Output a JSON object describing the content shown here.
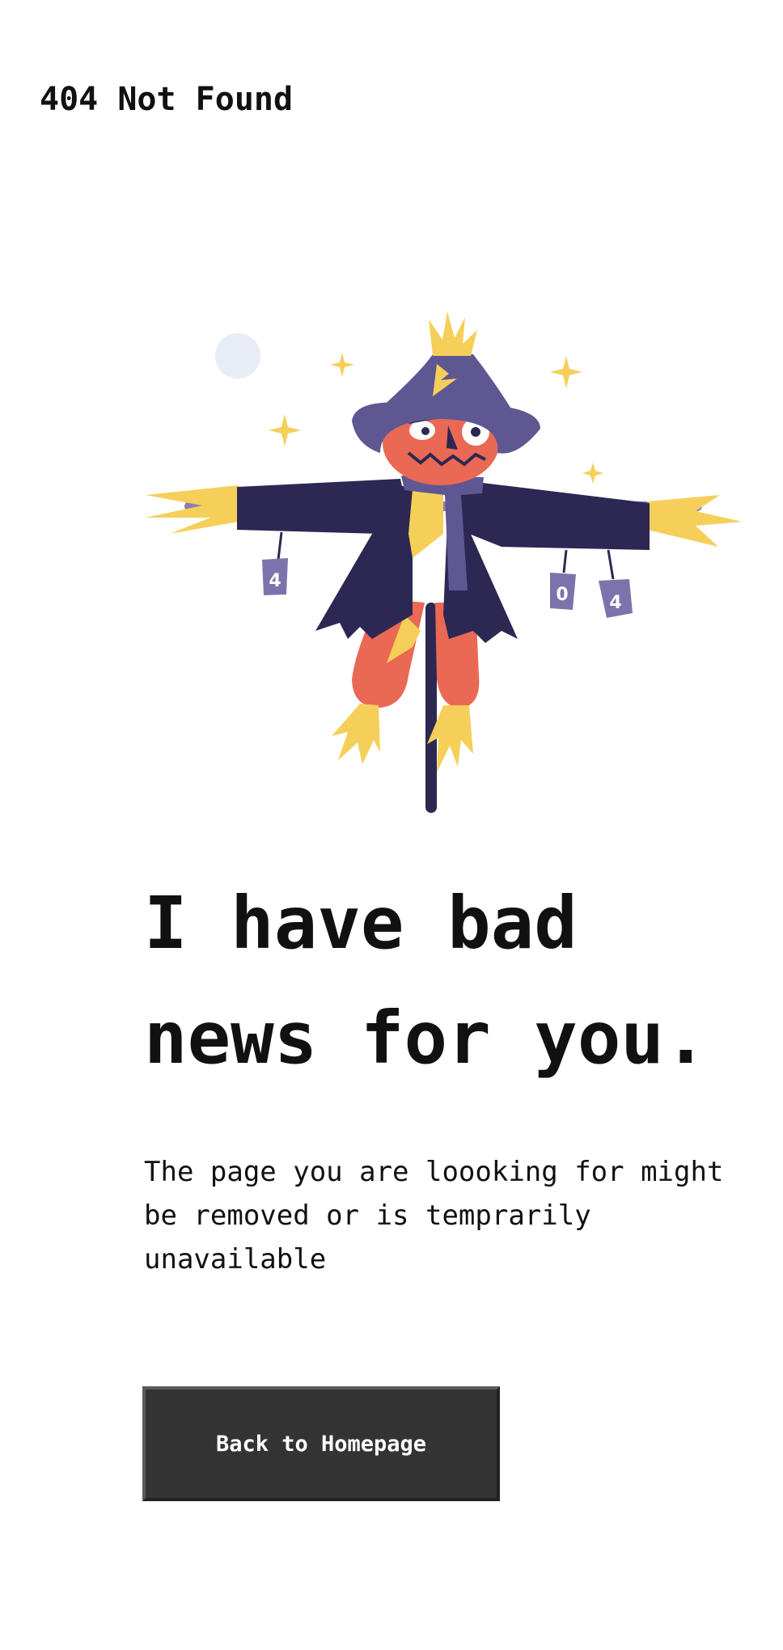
{
  "header": {
    "title": "404 Not Found"
  },
  "illustration": {
    "name": "scarecrow-illustration",
    "can_labels": [
      "4",
      "0",
      "4"
    ]
  },
  "main": {
    "headline_line1": "I have bad",
    "headline_line2": "news for you.",
    "message_line1": "The page you are loooking for might",
    "message_line2": "be removed or is temprarily",
    "message_line3": "unavailable",
    "button_label": "Back to Homepage"
  },
  "colors": {
    "button_bg": "#333333",
    "hat": "#5f5791",
    "coat": "#2d2753",
    "face": "#ea6954",
    "straw": "#f5cf59",
    "can": "#7d73ac",
    "moon": "#e8ecf6"
  }
}
